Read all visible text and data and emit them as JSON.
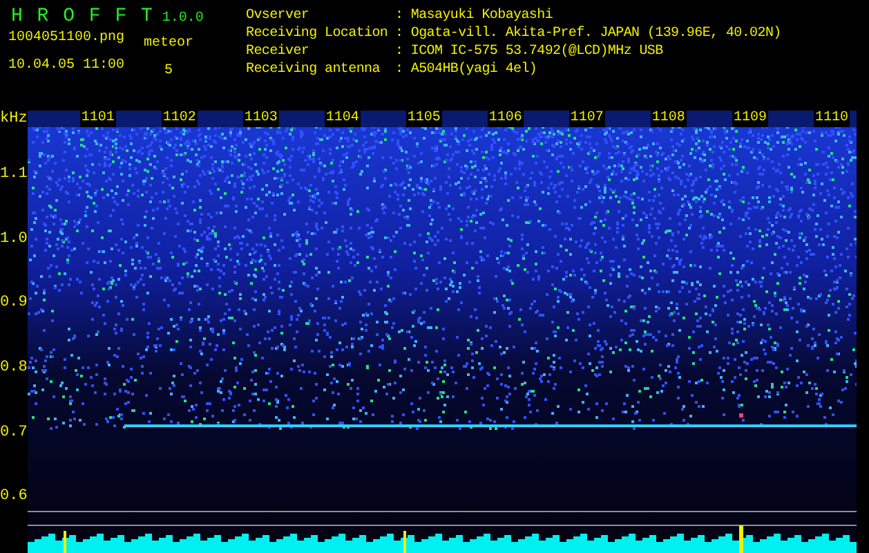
{
  "header": {
    "title": "H R O F F T",
    "version": "1.0.0",
    "filename": "1004051100.png",
    "datetime": "10.04.05 11:00",
    "meteor_label": "meteor",
    "meteor_count": "5"
  },
  "info": [
    {
      "label": "Ovserver",
      "value": ": Masayuki Kobayashi"
    },
    {
      "label": "Receiving Location",
      "value": ": Ogata-vill. Akita-Pref. JAPAN (139.96E, 40.02N)"
    },
    {
      "label": "Receiver",
      "value": ": ICOM IC-575 53.7492(@LCD)MHz USB"
    },
    {
      "label": "Receiving antenna",
      "value": ": A504HB(yagi 4el)"
    }
  ],
  "frequency_axis": {
    "unit": "kHz",
    "labels": [
      "1.1",
      "1.0",
      "0.9",
      "0.8",
      "0.7",
      "0.6"
    ]
  },
  "time_labels": [
    "1101",
    "1102",
    "1103",
    "1104",
    "1105",
    "1106",
    "1107",
    "1108",
    "1109",
    "1110"
  ]
}
